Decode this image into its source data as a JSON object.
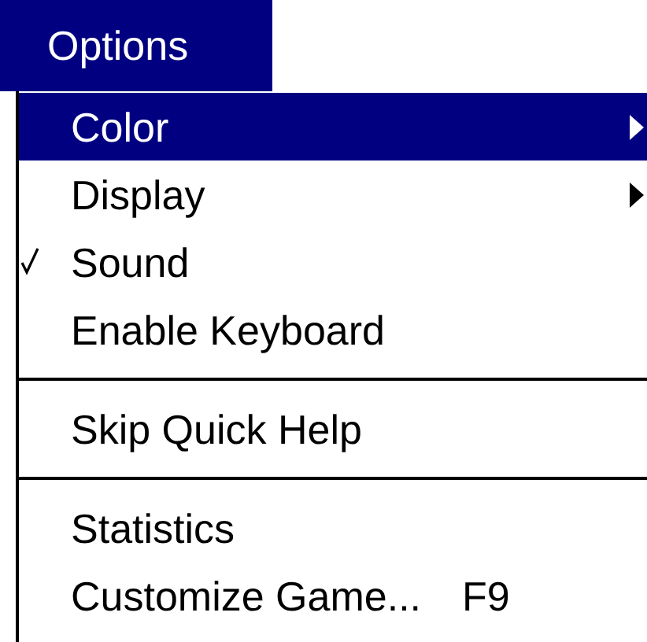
{
  "menu": {
    "title": "Options",
    "selected": true
  },
  "items": [
    {
      "kind": "submenu",
      "label": "Color",
      "selected": true,
      "checked": false
    },
    {
      "kind": "submenu",
      "label": "Display",
      "selected": false,
      "checked": false
    },
    {
      "kind": "command",
      "label": "Sound",
      "selected": false,
      "checked": true
    },
    {
      "kind": "command",
      "label": "Enable Keyboard",
      "selected": false,
      "checked": false
    },
    {
      "kind": "separator"
    },
    {
      "kind": "command",
      "label": "Skip Quick Help",
      "selected": false,
      "checked": false
    },
    {
      "kind": "separator"
    },
    {
      "kind": "command",
      "label": "Statistics",
      "selected": false,
      "checked": false
    },
    {
      "kind": "command",
      "label": "Customize Game...",
      "shortcut": "F9",
      "selected": false,
      "checked": false
    }
  ]
}
